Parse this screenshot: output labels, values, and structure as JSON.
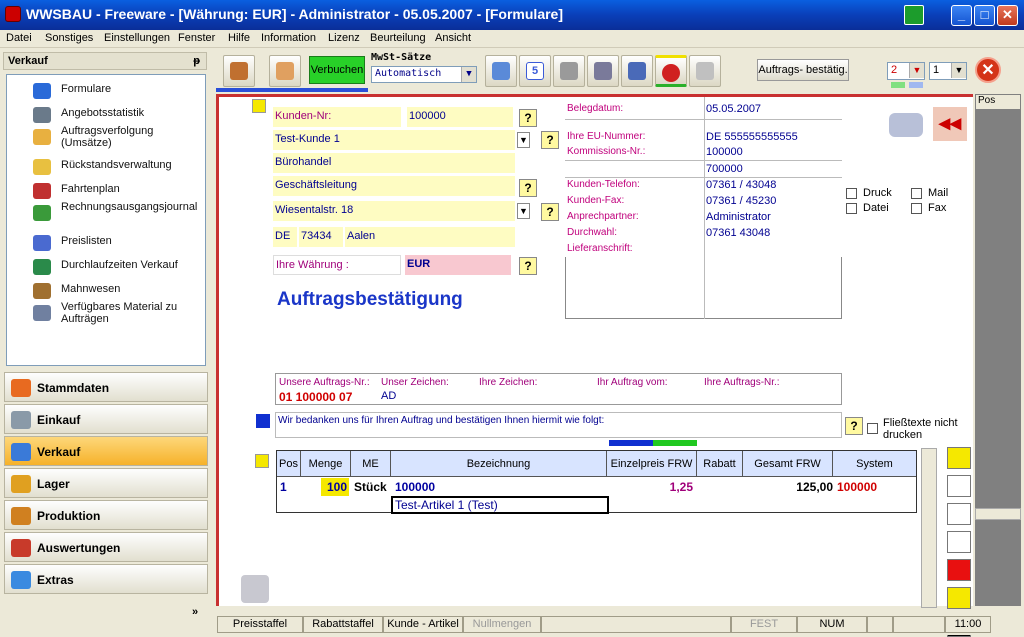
{
  "window": {
    "title": "WWSBAU - Freeware - [Währung: EUR] - Administrator - 05.05.2007 - [Formulare]",
    "min": "_",
    "max": "□",
    "close": "✕"
  },
  "menu": [
    "Datei",
    "Sonstiges",
    "Einstellungen",
    "Fenster",
    "Hilfe",
    "Information",
    "Lizenz",
    "Beurteilung",
    "Ansicht"
  ],
  "sidebar": {
    "header": "Verkauf",
    "pin": "ᵽ",
    "items": [
      "Formulare",
      "Angebotsstatistik",
      "Auftragsverfolgung (Umsätze)",
      "Rückstandsverwaltung",
      "Fahrtenplan",
      "Rechnungsausgangsjournal",
      "Preislisten",
      "Durchlaufzeiten Verkauf",
      "Mahnwesen",
      "Verfügbares Material zu Aufträgen"
    ],
    "groups": [
      "Stammdaten",
      "Einkauf",
      "Verkauf",
      "Lager",
      "Produktion",
      "Auswertungen",
      "Extras"
    ],
    "more": "»"
  },
  "toolbar": {
    "verbuchen": "Verbuchen",
    "mwst_label": "MwSt-Sätze",
    "mwst_value": "Automatisch",
    "doc_button": "Auftrags- bestätig.",
    "copies": "2",
    "page": "1",
    "close": "✕"
  },
  "form": {
    "kunden_nr_label": "Kunden-Nr:",
    "kunden_nr": "100000",
    "name": "Test-Kunde 1",
    "line2": "Bürohandel",
    "line3": "Geschäftsleitung",
    "street": "Wiesentalstr. 18",
    "country": "DE",
    "zip": "73434",
    "city": "Aalen",
    "waehrung_label": "Ihre Währung :",
    "waehrung": "EUR",
    "title": "Auftragsbestätigung",
    "right": [
      {
        "label": "Belegdatum:",
        "value": "05.05.2007"
      },
      {
        "label": "Ihre EU-Nummer:",
        "value": "DE 555555555555"
      },
      {
        "label": "Kommissions-Nr.:",
        "value": "100000"
      },
      {
        "label": "",
        "value": "700000"
      },
      {
        "label": "Kunden-Telefon:",
        "value": "07361 / 43048"
      },
      {
        "label": "Kunden-Fax:",
        "value": "07361 / 45230"
      },
      {
        "label": "Anprechpartner:",
        "value": "Administrator"
      },
      {
        "label": "Durchwahl:",
        "value": "07361 43048"
      },
      {
        "label": "Lieferanschrift:",
        "value": ""
      }
    ],
    "checks": {
      "druck": "Druck",
      "mail": "Mail",
      "datei": "Datei",
      "fax": "Fax"
    },
    "order_headers": [
      "Unsere Auftrags-Nr.:",
      "Unser Zeichen:",
      "Ihre Zeichen:",
      "Ihr Auftrag vom:",
      "Ihre Auftrags-Nr.:"
    ],
    "order_values": {
      "nr": "01 100000 07",
      "zeichen": "AD"
    },
    "intro": "Wir bedanken uns für Ihren Auftrag und bestätigen Ihnen hiermit wie folgt:",
    "fliess": "Fließtexte nicht drucken"
  },
  "table": {
    "headers": [
      "Pos",
      "Menge",
      "ME",
      "Bezeichnung",
      "Einzelpreis FRW",
      "Rabatt",
      "Gesamt FRW",
      "System"
    ],
    "row": {
      "pos": "1",
      "menge": "100",
      "me": "Stück",
      "bez": "100000",
      "preis": "1,25",
      "rabatt": "",
      "gesamt": "125,00",
      "system": "100000"
    },
    "subtext": "Test-Artikel 1  (Test)"
  },
  "pos_label": "Pos",
  "status": [
    "Preisstaffel",
    "Rabattstaffel",
    "Kunde - Artikel",
    "Nullmengen",
    "",
    "FEST",
    "NUM",
    "",
    "",
    "11:00"
  ]
}
